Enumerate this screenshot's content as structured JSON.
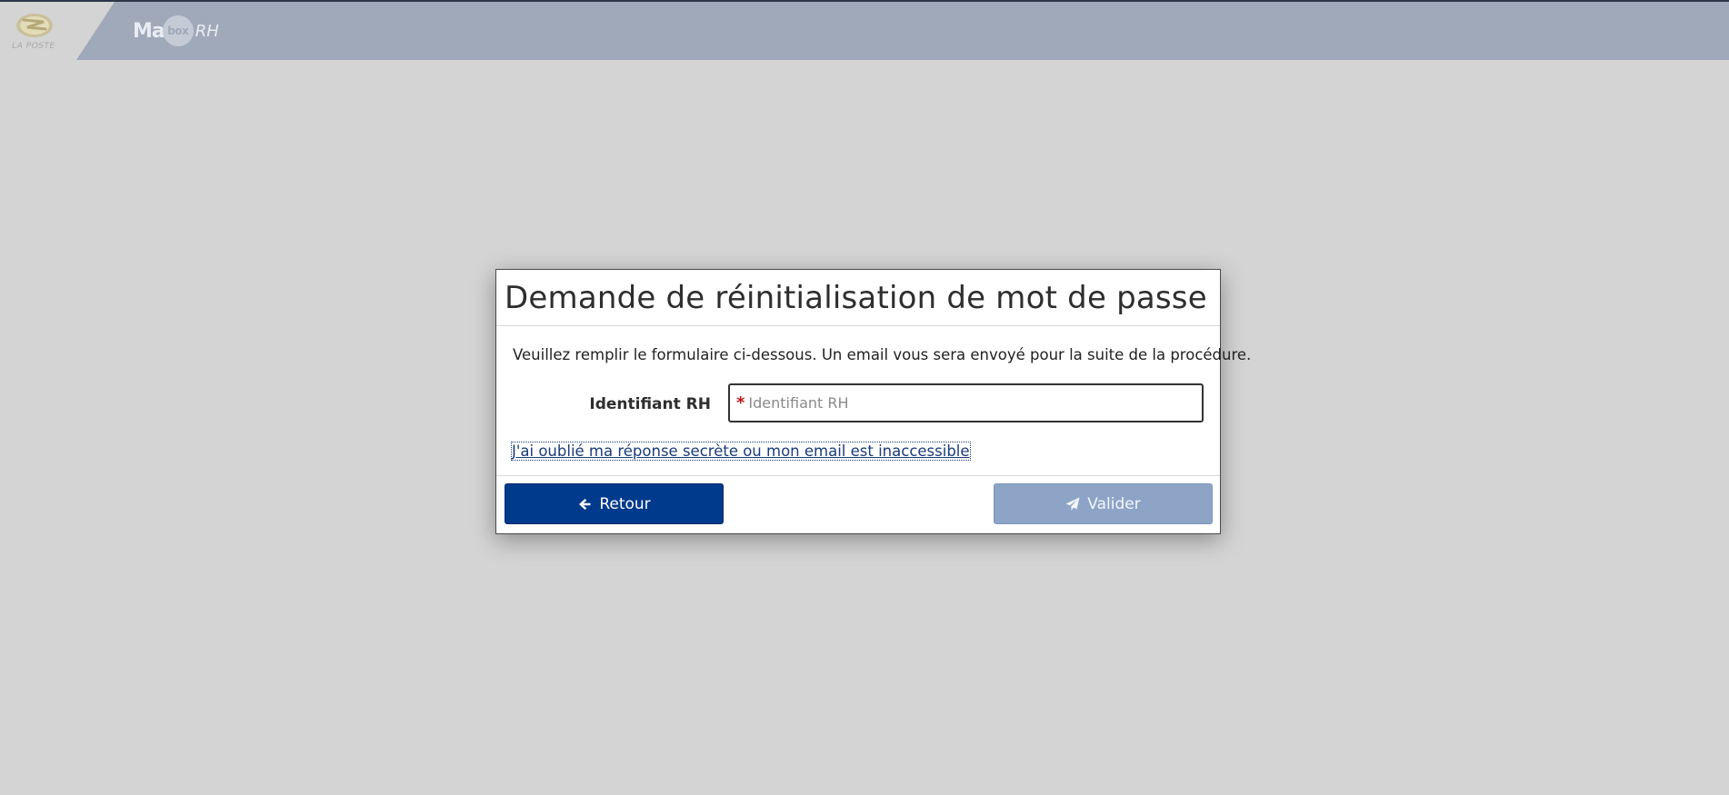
{
  "header": {
    "logo_text": "LA POSTE",
    "brand_prefix": "Ma",
    "brand_box": "box",
    "brand_suffix": "RH"
  },
  "modal": {
    "title": "Demande de réinitialisation de mot de passe",
    "instructions": "Veuillez remplir le formulaire ci-dessous. Un email vous sera envoyé pour la suite de la procédure.",
    "field": {
      "label": "Identifiant RH",
      "required_marker": "*",
      "placeholder": "Identifiant RH",
      "value": ""
    },
    "forgot_link": "J'ai oublié ma réponse secrète ou mon email est inaccessible",
    "buttons": {
      "back_label": "Retour",
      "back_icon": "arrow-left-icon",
      "submit_label": "Valider",
      "submit_icon": "paper-plane-icon"
    }
  },
  "colors": {
    "header_bg": "#a0a9b9",
    "page_bg": "#d4d4d4",
    "primary_button": "#003a8c",
    "disabled_button": "#8da4c7",
    "link": "#1a3c7a",
    "required": "#c0141b"
  }
}
